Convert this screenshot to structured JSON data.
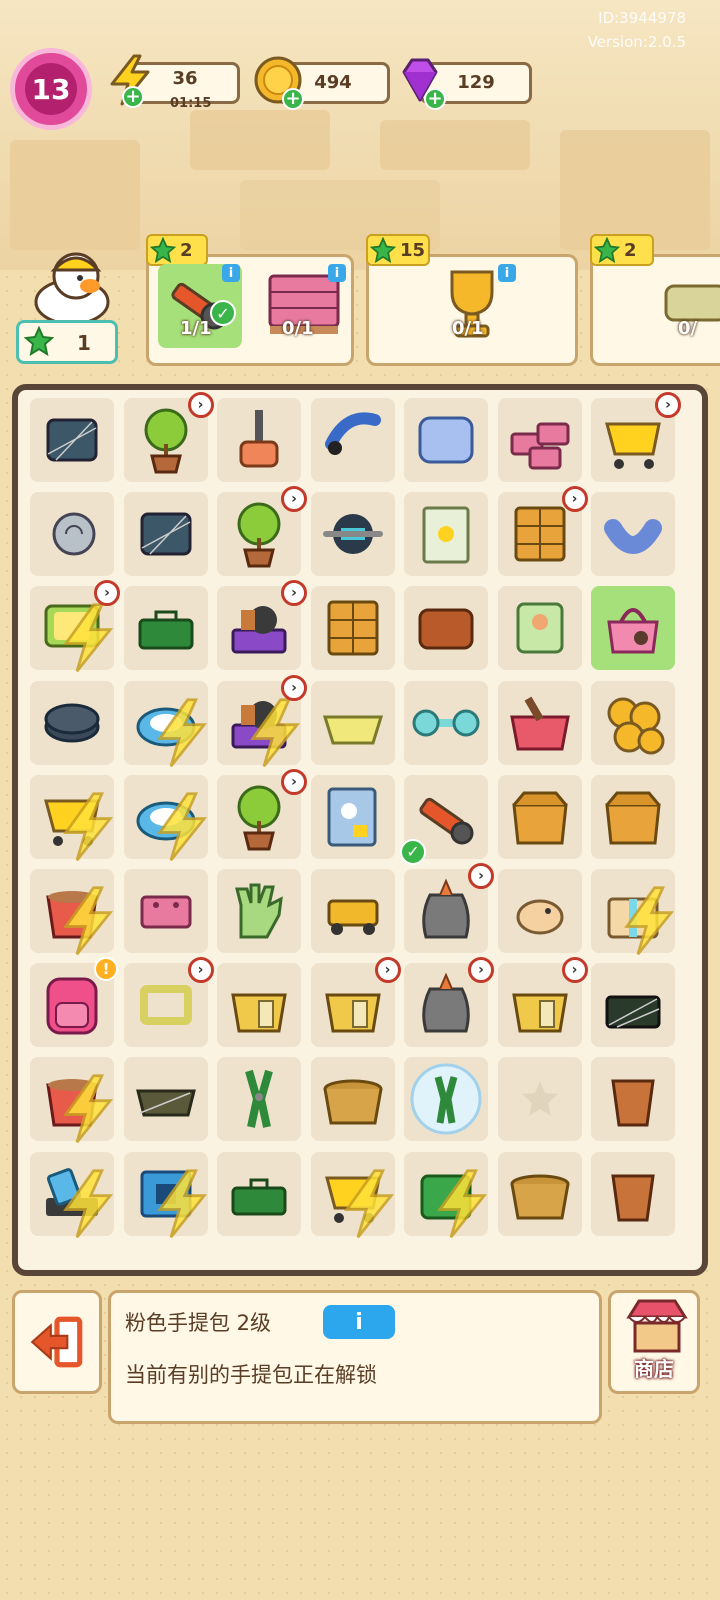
{
  "meta": {
    "id": "ID:3944978",
    "version": "Version:2.0.5"
  },
  "header": {
    "level": "13",
    "energy": {
      "value": "36",
      "timer": "01:15"
    },
    "coins": {
      "value": "494"
    },
    "gems": {
      "value": "129"
    }
  },
  "worker": {
    "count": "1"
  },
  "orders": [
    {
      "reward": "2",
      "items": [
        {
          "icon": "box-cutter",
          "progress": "1/1",
          "done": true
        },
        {
          "icon": "brick-pallet",
          "progress": "0/1",
          "done": false
        }
      ]
    },
    {
      "reward": "15",
      "items": [
        {
          "icon": "trophy",
          "progress": "0/1",
          "done": false
        }
      ]
    },
    {
      "reward": "2",
      "items": [
        {
          "icon": "paper-scroll",
          "progress": "0/",
          "done": false
        }
      ]
    }
  ],
  "board": {
    "rows": [
      [
        "dusty-chip",
        "potted-tree",
        "mallet",
        "headband",
        "pillow",
        "bricks",
        "shopping-cart"
      ],
      [
        "snail-shell",
        "dusty-chip",
        "potted-tree",
        "ab-wheel",
        "book-page",
        "drawer-cabinet",
        "neck-pillow"
      ],
      [
        "locked-tv",
        "toolbox",
        "purple-cart",
        "drawer-cabinet",
        "wallet",
        "cushion",
        "pink-handbag"
      ],
      [
        "weight-plates",
        "locked-robot-vacuum",
        "locked-purple-cart",
        "basket-tray",
        "dumbbell",
        "red-box",
        "coin-stack"
      ],
      [
        "locked-shopping-cart",
        "locked-robot-vacuum",
        "potted-tree",
        "notebook",
        "box-cutter",
        "cardboard-box",
        "cardboard-box"
      ],
      [
        "locked-bucket",
        "brick",
        "work-glove",
        "tape-dispenser",
        "trash-bag",
        "hamster",
        "locked-gift-box"
      ],
      [
        "pink-backpack",
        "frame",
        "paper-box",
        "paper-box",
        "trash-bag",
        "paper-box",
        "dusty-toolbox"
      ],
      [
        "locked-bucket",
        "dusty-tray",
        "pliers",
        "wicker-basket",
        "bubble-pliers",
        "empty",
        "flower-pot"
      ],
      [
        "locked-tool",
        "locked-chip",
        "green-toolbox",
        "locked-shopping-cart",
        "locked-green-box",
        "wicker-basket",
        "flower-pot"
      ]
    ]
  },
  "info_panel": {
    "title": "粉色手提包 2级",
    "info_label": "i",
    "description": "当前有别的手提包正在解锁"
  },
  "shop": {
    "label": "商店"
  },
  "colors": {
    "accent_green": "#3ab54a",
    "accent_blue": "#2ca6ec",
    "level_pink": "#e14a9a",
    "border_dark": "#5a4638"
  }
}
